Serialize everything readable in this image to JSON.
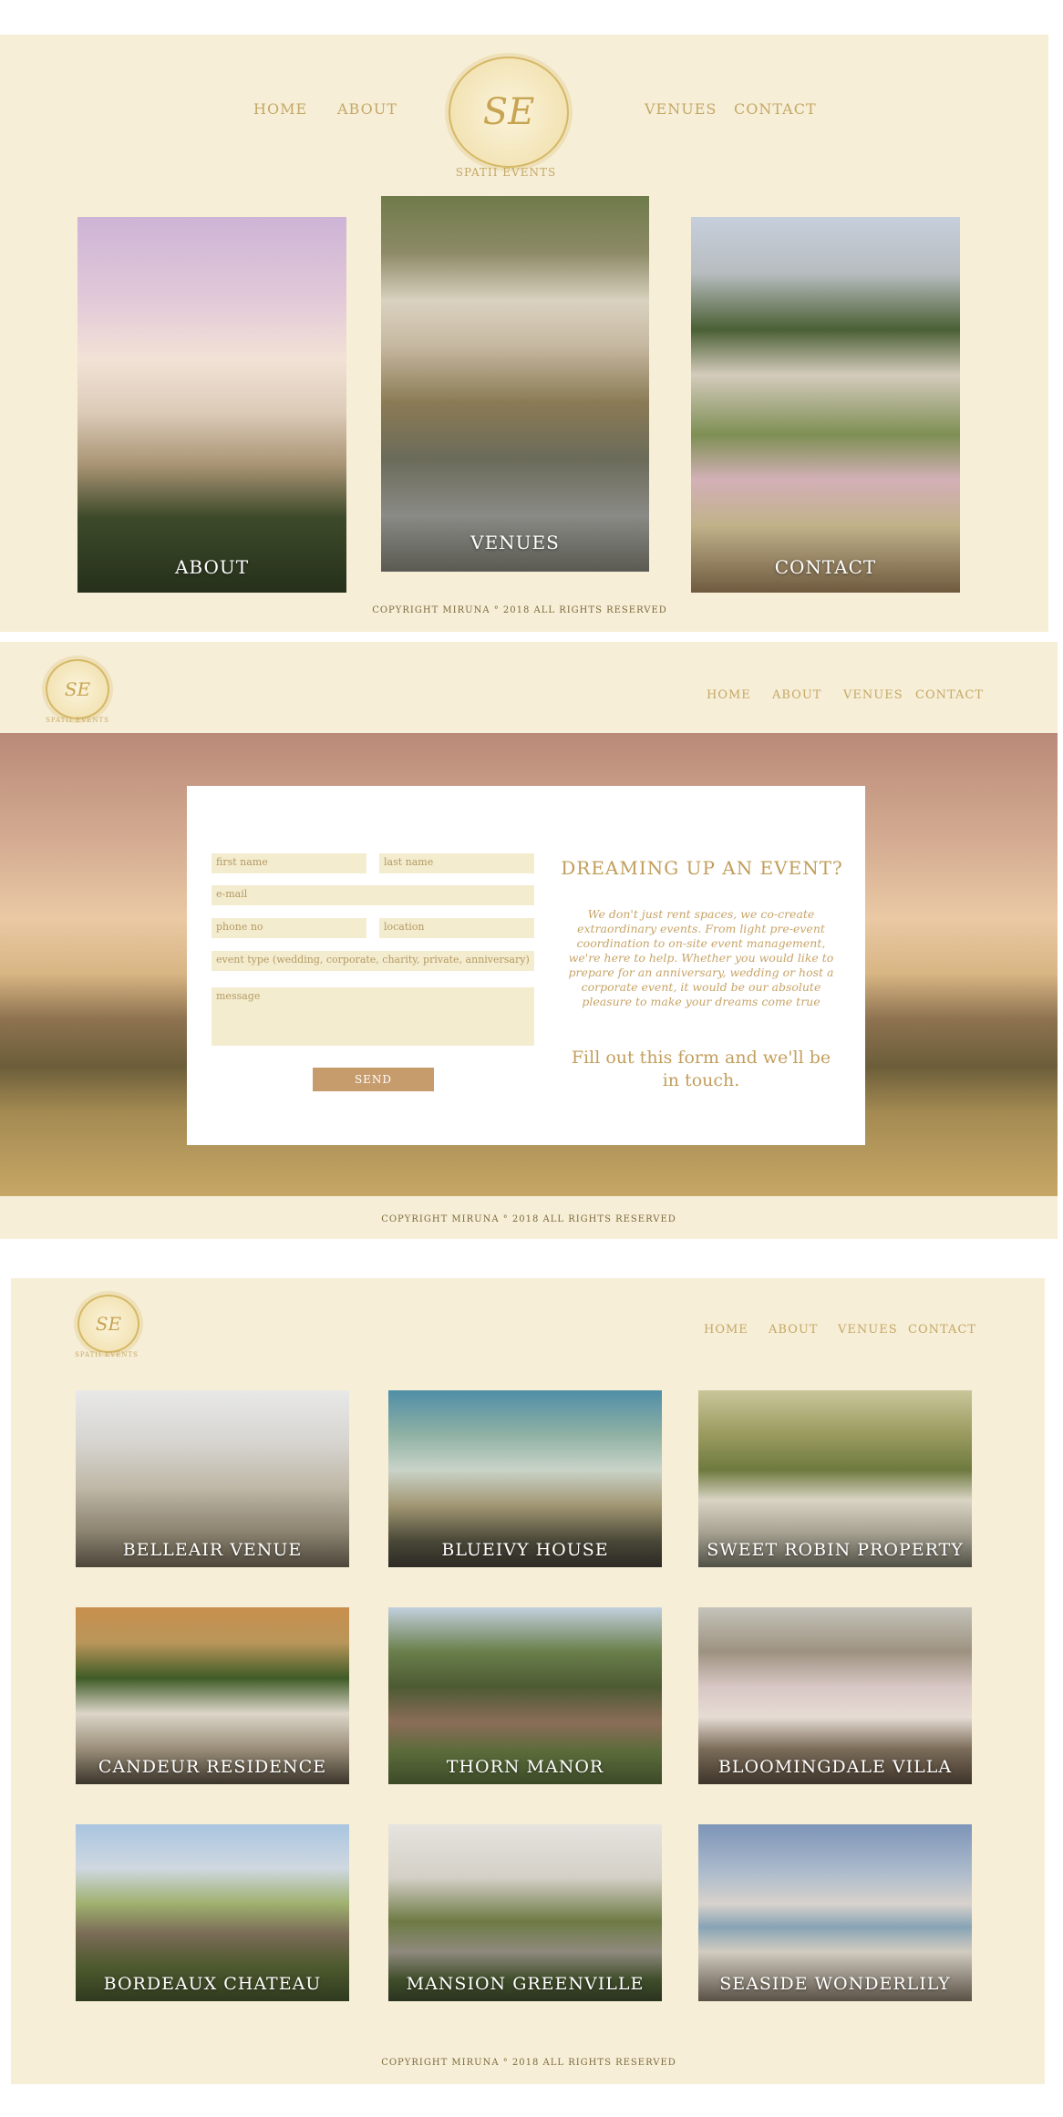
{
  "brand": {
    "monogram": "SE",
    "name": "SPATII EVENTS"
  },
  "colors": {
    "panel_bg": "#f6eed6",
    "gold": "#c5a867",
    "button": "#c79c6d"
  },
  "home_page": {
    "nav": {
      "home": "HOME",
      "about": "ABOUT",
      "venues": "VENUES",
      "contact": "CONTACT"
    },
    "tiles": [
      {
        "label": "ABOUT"
      },
      {
        "label": "VENUES"
      },
      {
        "label": "CONTACT"
      }
    ],
    "copyright": "COPYRIGHT MIRUNA ° 2018 ALL RIGHTS RESERVED"
  },
  "contact_page": {
    "nav": {
      "home": "HOME",
      "about": "ABOUT",
      "venues": "VENUES",
      "contact": "CONTACT"
    },
    "form": {
      "first_name": "first name",
      "last_name": "last name",
      "email": "e-mail",
      "phone": "phone no",
      "location": "location",
      "event_type": "event type (wedding, corporate, charity, private, anniversary)",
      "message": "message",
      "send": "SEND"
    },
    "title": "DREAMING UP AN EVENT?",
    "body": "We don't just rent spaces, we co-create extraordinary events. From light pre-event coordination to on-site event management, we're here to help. Whether you would like to prepare for an anniversary, wedding or host a corporate event, it would be our absolute pleasure to make your dreams come true",
    "cta": "Fill out this form and we'll be in touch.",
    "copyright": "COPYRIGHT MIRUNA ° 2018 ALL RIGHTS RESERVED"
  },
  "venues_page": {
    "nav": {
      "home": "HOME",
      "about": "ABOUT",
      "venues": "VENUES",
      "contact": "CONTACT"
    },
    "venues": [
      {
        "label": "BELLEAIR VENUE"
      },
      {
        "label": "BLUEIVY HOUSE"
      },
      {
        "label": "SWEET ROBIN PROPERTY"
      },
      {
        "label": "CANDEUR RESIDENCE"
      },
      {
        "label": "THORN MANOR"
      },
      {
        "label": "BLOOMINGDALE VILLA"
      },
      {
        "label": "BORDEAUX CHATEAU"
      },
      {
        "label": "MANSION GREENVILLE"
      },
      {
        "label": "SEASIDE WONDERLILY"
      }
    ],
    "copyright": "COPYRIGHT MIRUNA ° 2018 ALL RIGHTS RESERVED"
  }
}
